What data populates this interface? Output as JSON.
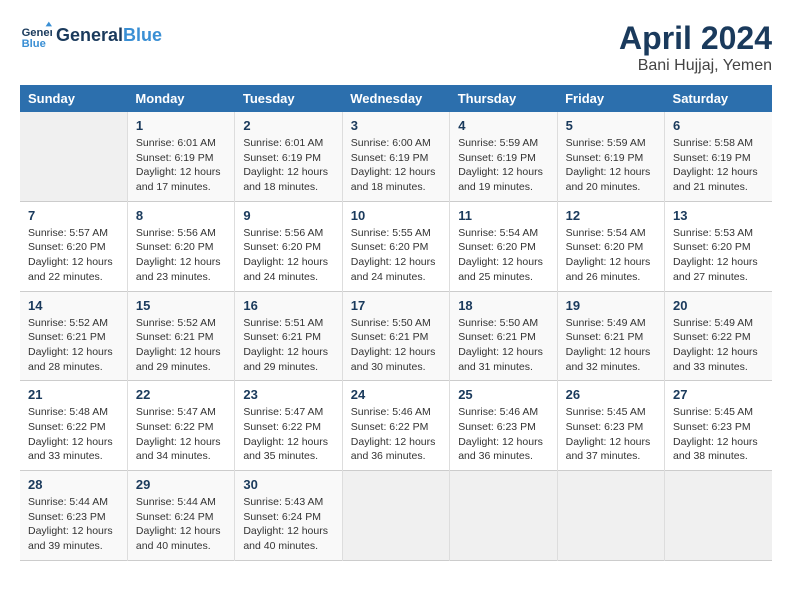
{
  "header": {
    "logo_line1": "General",
    "logo_line2": "Blue",
    "title": "April 2024",
    "subtitle": "Bani Hujjaj, Yemen"
  },
  "weekdays": [
    "Sunday",
    "Monday",
    "Tuesday",
    "Wednesday",
    "Thursday",
    "Friday",
    "Saturday"
  ],
  "weeks": [
    [
      {
        "day": "",
        "info": ""
      },
      {
        "day": "1",
        "info": "Sunrise: 6:01 AM\nSunset: 6:19 PM\nDaylight: 12 hours\nand 17 minutes."
      },
      {
        "day": "2",
        "info": "Sunrise: 6:01 AM\nSunset: 6:19 PM\nDaylight: 12 hours\nand 18 minutes."
      },
      {
        "day": "3",
        "info": "Sunrise: 6:00 AM\nSunset: 6:19 PM\nDaylight: 12 hours\nand 18 minutes."
      },
      {
        "day": "4",
        "info": "Sunrise: 5:59 AM\nSunset: 6:19 PM\nDaylight: 12 hours\nand 19 minutes."
      },
      {
        "day": "5",
        "info": "Sunrise: 5:59 AM\nSunset: 6:19 PM\nDaylight: 12 hours\nand 20 minutes."
      },
      {
        "day": "6",
        "info": "Sunrise: 5:58 AM\nSunset: 6:19 PM\nDaylight: 12 hours\nand 21 minutes."
      }
    ],
    [
      {
        "day": "7",
        "info": "Sunrise: 5:57 AM\nSunset: 6:20 PM\nDaylight: 12 hours\nand 22 minutes."
      },
      {
        "day": "8",
        "info": "Sunrise: 5:56 AM\nSunset: 6:20 PM\nDaylight: 12 hours\nand 23 minutes."
      },
      {
        "day": "9",
        "info": "Sunrise: 5:56 AM\nSunset: 6:20 PM\nDaylight: 12 hours\nand 24 minutes."
      },
      {
        "day": "10",
        "info": "Sunrise: 5:55 AM\nSunset: 6:20 PM\nDaylight: 12 hours\nand 24 minutes."
      },
      {
        "day": "11",
        "info": "Sunrise: 5:54 AM\nSunset: 6:20 PM\nDaylight: 12 hours\nand 25 minutes."
      },
      {
        "day": "12",
        "info": "Sunrise: 5:54 AM\nSunset: 6:20 PM\nDaylight: 12 hours\nand 26 minutes."
      },
      {
        "day": "13",
        "info": "Sunrise: 5:53 AM\nSunset: 6:20 PM\nDaylight: 12 hours\nand 27 minutes."
      }
    ],
    [
      {
        "day": "14",
        "info": "Sunrise: 5:52 AM\nSunset: 6:21 PM\nDaylight: 12 hours\nand 28 minutes."
      },
      {
        "day": "15",
        "info": "Sunrise: 5:52 AM\nSunset: 6:21 PM\nDaylight: 12 hours\nand 29 minutes."
      },
      {
        "day": "16",
        "info": "Sunrise: 5:51 AM\nSunset: 6:21 PM\nDaylight: 12 hours\nand 29 minutes."
      },
      {
        "day": "17",
        "info": "Sunrise: 5:50 AM\nSunset: 6:21 PM\nDaylight: 12 hours\nand 30 minutes."
      },
      {
        "day": "18",
        "info": "Sunrise: 5:50 AM\nSunset: 6:21 PM\nDaylight: 12 hours\nand 31 minutes."
      },
      {
        "day": "19",
        "info": "Sunrise: 5:49 AM\nSunset: 6:21 PM\nDaylight: 12 hours\nand 32 minutes."
      },
      {
        "day": "20",
        "info": "Sunrise: 5:49 AM\nSunset: 6:22 PM\nDaylight: 12 hours\nand 33 minutes."
      }
    ],
    [
      {
        "day": "21",
        "info": "Sunrise: 5:48 AM\nSunset: 6:22 PM\nDaylight: 12 hours\nand 33 minutes."
      },
      {
        "day": "22",
        "info": "Sunrise: 5:47 AM\nSunset: 6:22 PM\nDaylight: 12 hours\nand 34 minutes."
      },
      {
        "day": "23",
        "info": "Sunrise: 5:47 AM\nSunset: 6:22 PM\nDaylight: 12 hours\nand 35 minutes."
      },
      {
        "day": "24",
        "info": "Sunrise: 5:46 AM\nSunset: 6:22 PM\nDaylight: 12 hours\nand 36 minutes."
      },
      {
        "day": "25",
        "info": "Sunrise: 5:46 AM\nSunset: 6:23 PM\nDaylight: 12 hours\nand 36 minutes."
      },
      {
        "day": "26",
        "info": "Sunrise: 5:45 AM\nSunset: 6:23 PM\nDaylight: 12 hours\nand 37 minutes."
      },
      {
        "day": "27",
        "info": "Sunrise: 5:45 AM\nSunset: 6:23 PM\nDaylight: 12 hours\nand 38 minutes."
      }
    ],
    [
      {
        "day": "28",
        "info": "Sunrise: 5:44 AM\nSunset: 6:23 PM\nDaylight: 12 hours\nand 39 minutes."
      },
      {
        "day": "29",
        "info": "Sunrise: 5:44 AM\nSunset: 6:24 PM\nDaylight: 12 hours\nand 40 minutes."
      },
      {
        "day": "30",
        "info": "Sunrise: 5:43 AM\nSunset: 6:24 PM\nDaylight: 12 hours\nand 40 minutes."
      },
      {
        "day": "",
        "info": ""
      },
      {
        "day": "",
        "info": ""
      },
      {
        "day": "",
        "info": ""
      },
      {
        "day": "",
        "info": ""
      }
    ]
  ]
}
